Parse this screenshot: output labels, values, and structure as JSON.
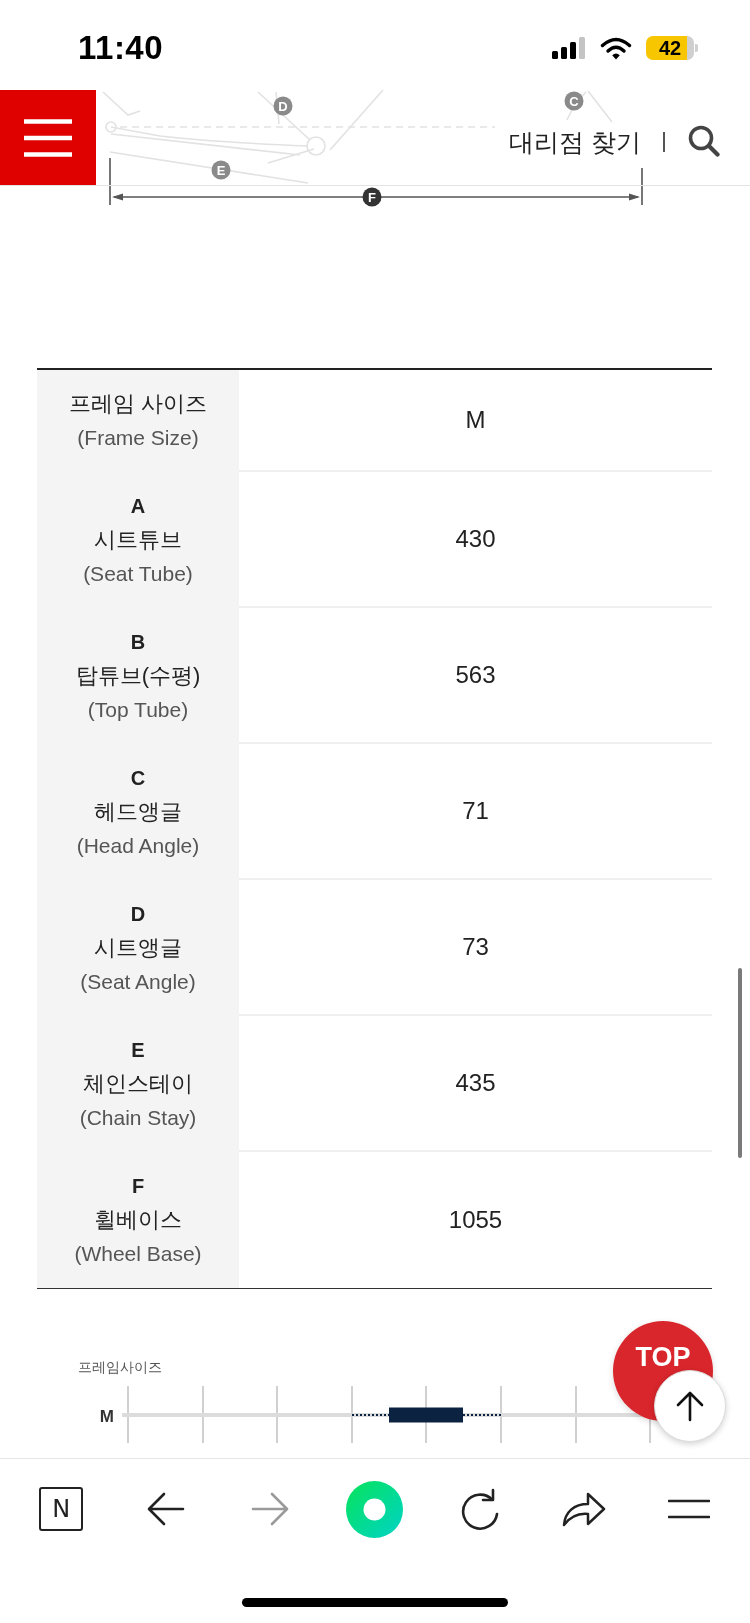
{
  "status_bar": {
    "time": "11:40",
    "battery": "42"
  },
  "header": {
    "link": "대리점 찾기"
  },
  "diagram": {
    "labels": [
      {
        "text": "D",
        "faded": true
      },
      {
        "text": "C",
        "faded": true
      },
      {
        "text": "E",
        "faded": true
      },
      {
        "text": "F",
        "faded": false
      }
    ]
  },
  "geometry_table": {
    "rows": [
      {
        "name": "프레임 사이즈",
        "name_en": "(Frame Size)",
        "value": "M"
      },
      {
        "letter": "A",
        "name": "시트튜브",
        "name_en": "(Seat Tube)",
        "value": "430"
      },
      {
        "letter": "B",
        "name": "탑튜브(수평)",
        "name_en": "(Top Tube)",
        "value": "563"
      },
      {
        "letter": "C",
        "name": "헤드앵글",
        "name_en": "(Head Angle)",
        "value": "71"
      },
      {
        "letter": "D",
        "name": "시트앵글",
        "name_en": "(Seat Angle)",
        "value": "73"
      },
      {
        "letter": "E",
        "name": "체인스테이",
        "name_en": "(Chain Stay)",
        "value": "435"
      },
      {
        "letter": "F",
        "name": "휠베이스",
        "name_en": "(Wheel Base)",
        "value": "1055"
      }
    ]
  },
  "size_chart": {
    "title": "프레임사이즈",
    "rows": [
      {
        "label": "M"
      }
    ]
  },
  "floating_buttons": {
    "top": "TOP"
  },
  "toolbar": {
    "items": [
      {
        "kind": "logo",
        "label": "N",
        "disabled": false
      },
      {
        "kind": "back",
        "disabled": false
      },
      {
        "kind": "forward",
        "disabled": true
      },
      {
        "kind": "ring",
        "disabled": false
      },
      {
        "kind": "reload",
        "disabled": false
      },
      {
        "kind": "share",
        "disabled": false
      },
      {
        "kind": "menu",
        "disabled": false
      }
    ]
  }
}
